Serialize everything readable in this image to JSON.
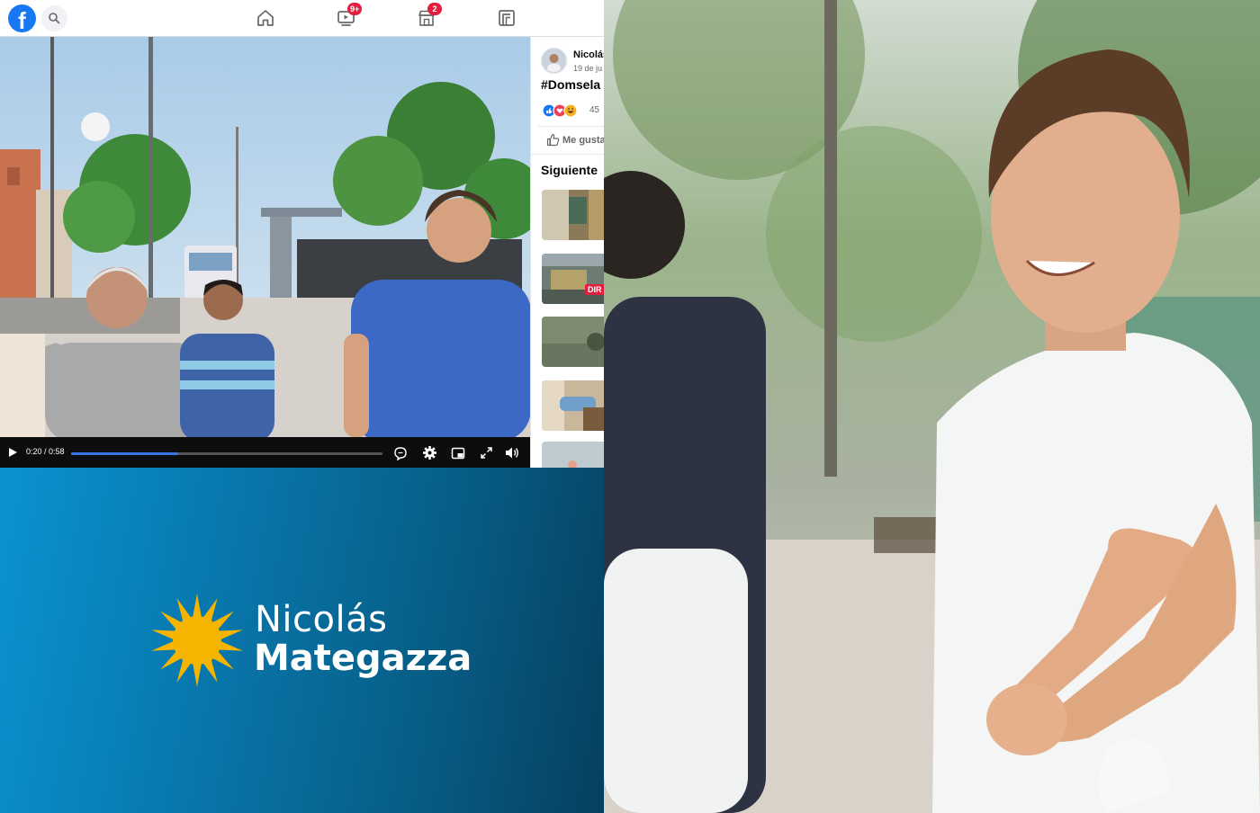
{
  "facebook": {
    "logo_letter": "f",
    "nav": {
      "watch_badge": "9+",
      "marketplace_badge": "2"
    },
    "video": {
      "current_time": "0:20",
      "duration": "0:58",
      "time_separator": " / ",
      "progress": 0.345
    },
    "post": {
      "author": "Nicolás",
      "date": "19 de ju",
      "hashtag": "#Domsela",
      "reaction_count": "45",
      "like_label": "Me gusta",
      "next_title": "Siguiente",
      "live_badge": "DIR"
    }
  },
  "brand": {
    "first_name": "Nicolás",
    "last_name": "Mategazza",
    "colors": {
      "gradient_start": "#0a93d1",
      "gradient_end": "#06405e",
      "sun": "#f5b400"
    }
  },
  "colors": {
    "facebook_blue": "#1877f2",
    "badge_red": "#e41e3f",
    "progress_blue": "#3578e5"
  }
}
